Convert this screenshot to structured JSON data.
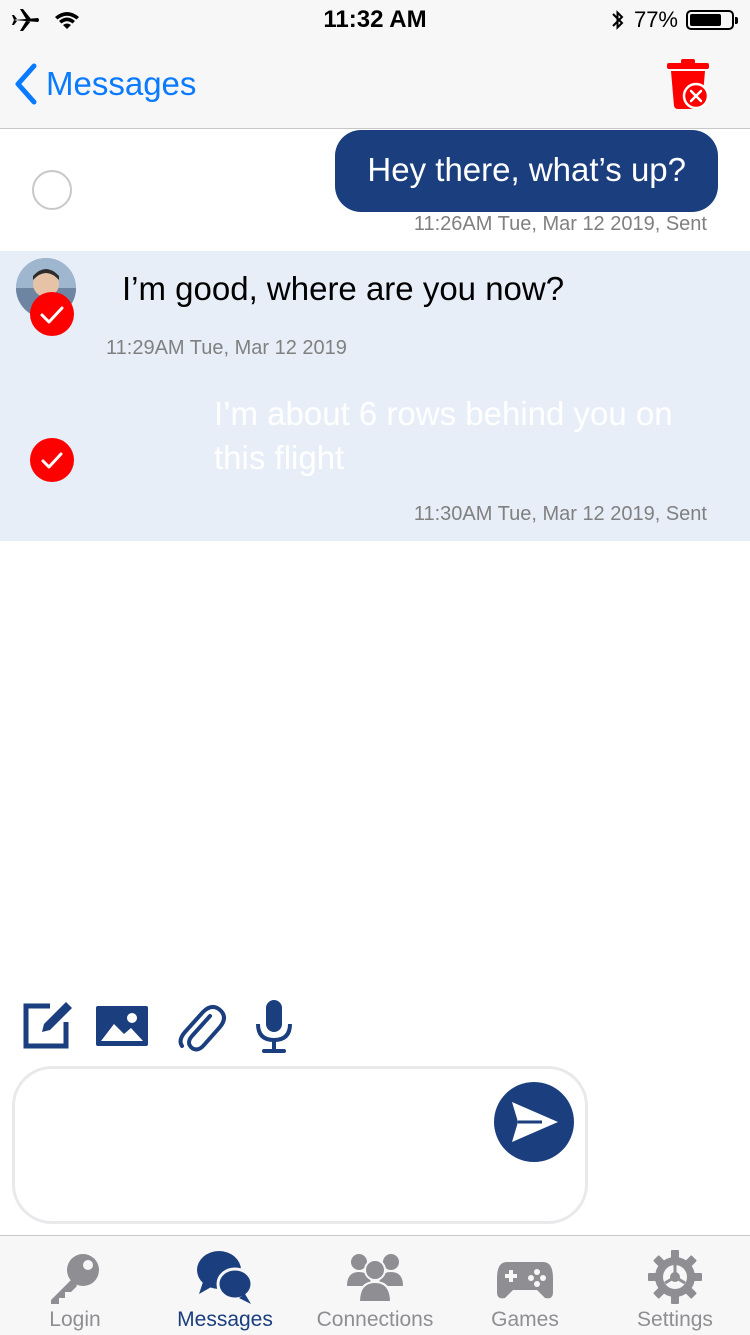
{
  "status_bar": {
    "time": "11:32 AM",
    "battery": "77%",
    "battery_level": 0.77,
    "icons": [
      "airplane-icon",
      "wifi-icon",
      "bluetooth-icon",
      "battery-icon"
    ]
  },
  "nav": {
    "back_label": "Messages",
    "delete_icon": "trash-delete-icon"
  },
  "messages": [
    {
      "direction": "outgoing",
      "text": "Hey there, what’s up?",
      "timestamp": "11:26AM Tue, Mar 12 2019, Sent",
      "selected": false
    },
    {
      "direction": "incoming",
      "text": "I’m good, where are you now?",
      "timestamp": "11:29AM Tue, Mar 12 2019",
      "selected": true
    },
    {
      "direction": "outgoing",
      "text": "I’m about 6 rows behind you on this flight",
      "timestamp": "11:30AM Tue, Mar 12 2019, Sent",
      "selected": true
    }
  ],
  "composer": {
    "tools": [
      "compose-icon",
      "image-icon",
      "attachment-icon",
      "microphone-icon"
    ],
    "input_value": "",
    "send_icon": "send-icon"
  },
  "tabs": [
    {
      "label": "Login",
      "icon": "key-icon",
      "active": false
    },
    {
      "label": "Messages",
      "icon": "chat-bubbles-icon",
      "active": true
    },
    {
      "label": "Connections",
      "icon": "people-icon",
      "active": false
    },
    {
      "label": "Games",
      "icon": "gamepad-icon",
      "active": false
    },
    {
      "label": "Settings",
      "icon": "gear-icon",
      "active": false
    }
  ],
  "colors": {
    "brand": "#1a3e7e",
    "ios_blue": "#0a7aff",
    "destructive": "#ff0000",
    "selection_bg": "#e8eef8",
    "tab_inactive": "#8e8e93"
  }
}
